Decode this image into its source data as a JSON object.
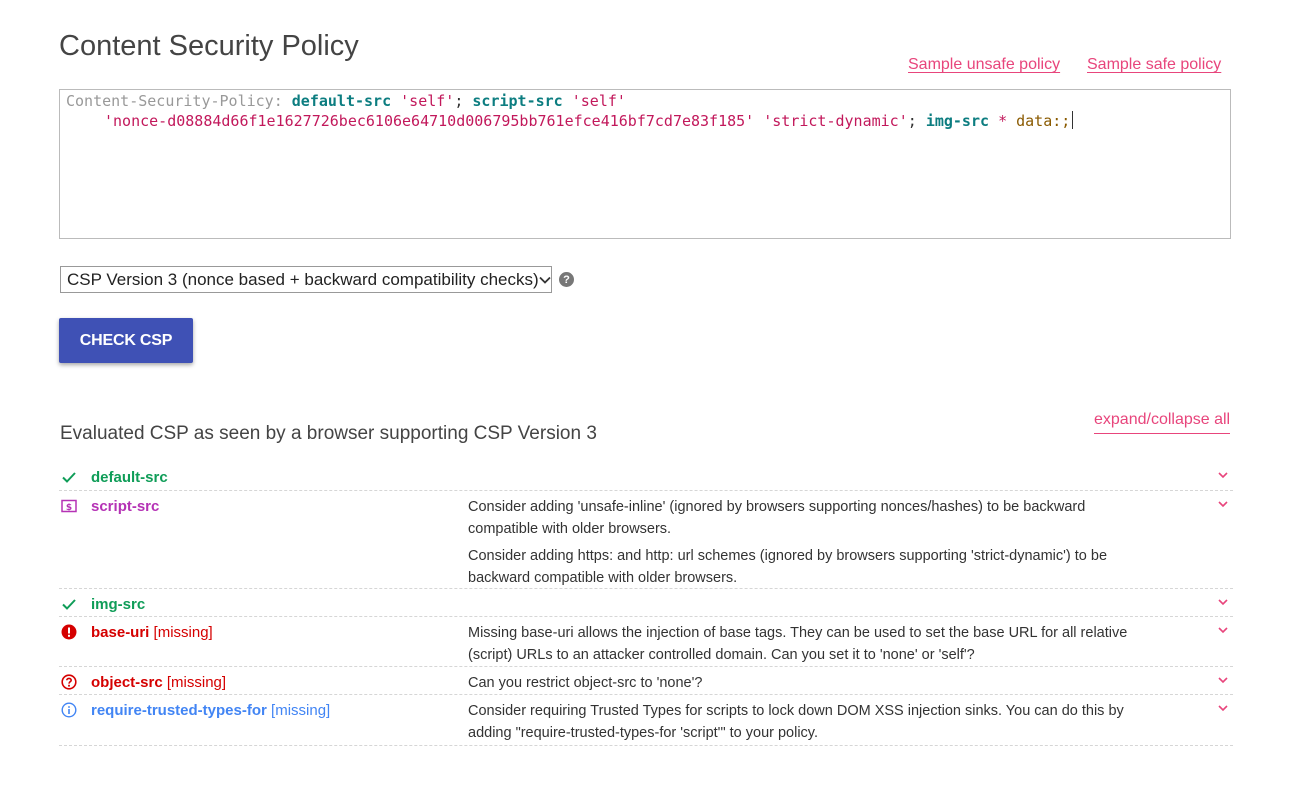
{
  "page": {
    "title": "Content Security Policy",
    "sample_unsafe": "Sample unsafe policy",
    "sample_safe": "Sample safe policy"
  },
  "editor": {
    "header": "Content-Security-Policy:",
    "default_src": "default-src",
    "self_1": "'self'",
    "semi": ";",
    "script_src": "script-src",
    "self_2": "'self'",
    "nonce": "'nonce-d08884d66f1e1627726bec6106e64710d006795bb761efce416bf7cd7e83f185'",
    "strict_dynamic": "'strict-dynamic'",
    "img_src": "img-src",
    "star": "*",
    "data_scheme": "data:",
    "end": ";"
  },
  "version_select": {
    "selected": "CSP Version 3 (nonce based + backward compatibility checks)"
  },
  "help_icon": "?",
  "check_button": "CHECK CSP",
  "results": {
    "heading": "Evaluated CSP as seen by a browser supporting CSP Version 3",
    "expand_all": "expand/collapse all",
    "rows": [
      {
        "icon": "check-icon",
        "directive": "default-src",
        "missing": "",
        "color": "#0f9d58",
        "messages": []
      },
      {
        "icon": "dollar-badge-icon",
        "directive": "script-src",
        "missing": "",
        "color": "#b532b5",
        "messages": [
          "Consider adding 'unsafe-inline' (ignored by browsers supporting nonces/hashes) to be backward compatible with older browsers.",
          "Consider adding https: and http: url schemes (ignored by browsers supporting 'strict-dynamic') to be backward compatible with older browsers."
        ]
      },
      {
        "icon": "check-icon",
        "directive": "img-src",
        "missing": "",
        "color": "#0f9d58",
        "messages": []
      },
      {
        "icon": "error-icon",
        "directive": "base-uri",
        "missing": "[missing]",
        "color": "#d50000",
        "messages": [
          "Missing base-uri allows the injection of base tags. They can be used to set the base URL for all relative (script) URLs to an attacker controlled domain. Can you set it to 'none' or 'self'?"
        ]
      },
      {
        "icon": "help-circle-icon",
        "directive": "object-src",
        "missing": "[missing]",
        "color": "#d50000",
        "messages": [
          "Can you restrict object-src to 'none'?"
        ]
      },
      {
        "icon": "info-icon",
        "directive": "require-trusted-types-for",
        "missing": "[missing]",
        "color": "#4285f4",
        "messages": [
          "Consider requiring Trusted Types for scripts to lock down DOM XSS injection sinks. You can do this by adding \"require-trusted-types-for 'script'\" to your policy."
        ]
      }
    ]
  },
  "colors": {
    "accent": "#3f51b5",
    "link": "#e8457c"
  }
}
